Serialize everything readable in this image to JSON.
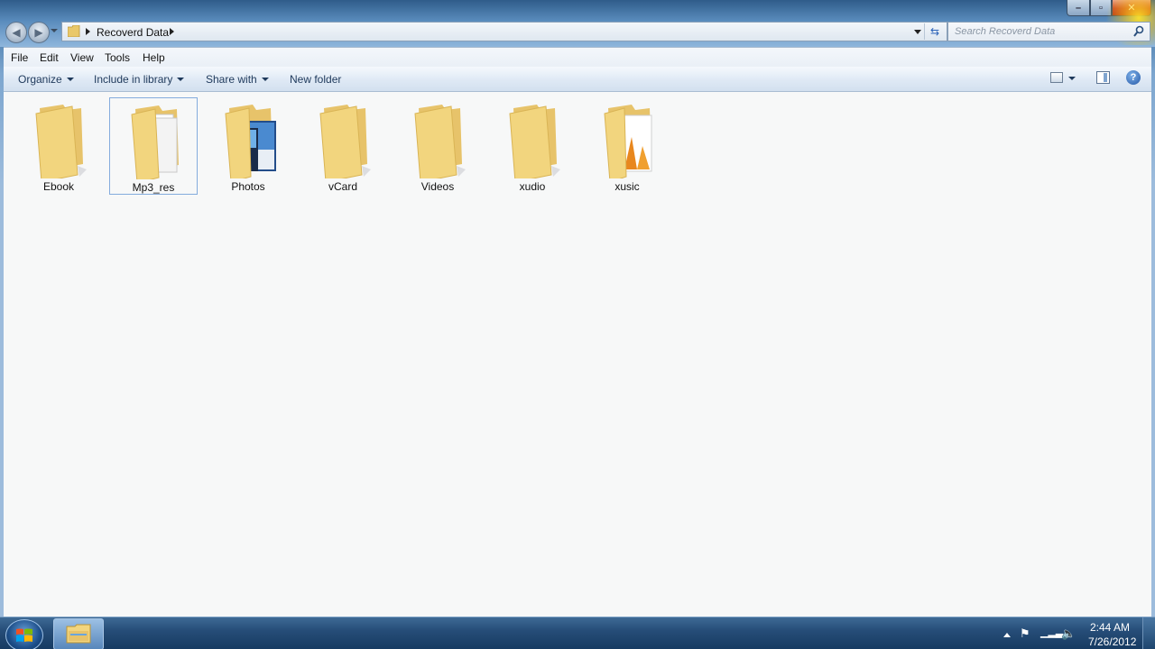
{
  "window": {
    "address": {
      "crumb": "Recoverd Data"
    },
    "search": {
      "placeholder": "Search Recoverd Data"
    }
  },
  "menu": [
    "File",
    "Edit",
    "View",
    "Tools",
    "Help"
  ],
  "command_bar": {
    "organize": "Organize",
    "include_in_library": "Include in library",
    "share_with": "Share with",
    "new_folder": "New folder"
  },
  "folders": [
    {
      "name": "Ebook",
      "kind": "plain"
    },
    {
      "name": "Mp3_res",
      "kind": "documents",
      "selected": true
    },
    {
      "name": "Photos",
      "kind": "photos"
    },
    {
      "name": "vCard",
      "kind": "plain"
    },
    {
      "name": "Videos",
      "kind": "plain"
    },
    {
      "name": "xudio",
      "kind": "plain"
    },
    {
      "name": "xusic",
      "kind": "orange-documents"
    }
  ],
  "taskbar": {
    "time": "2:44 AM",
    "date": "7/26/2012"
  },
  "colors": {
    "folder": "#f2d57e",
    "selection_border": "#84acdd",
    "close_button": "#c8452a"
  }
}
